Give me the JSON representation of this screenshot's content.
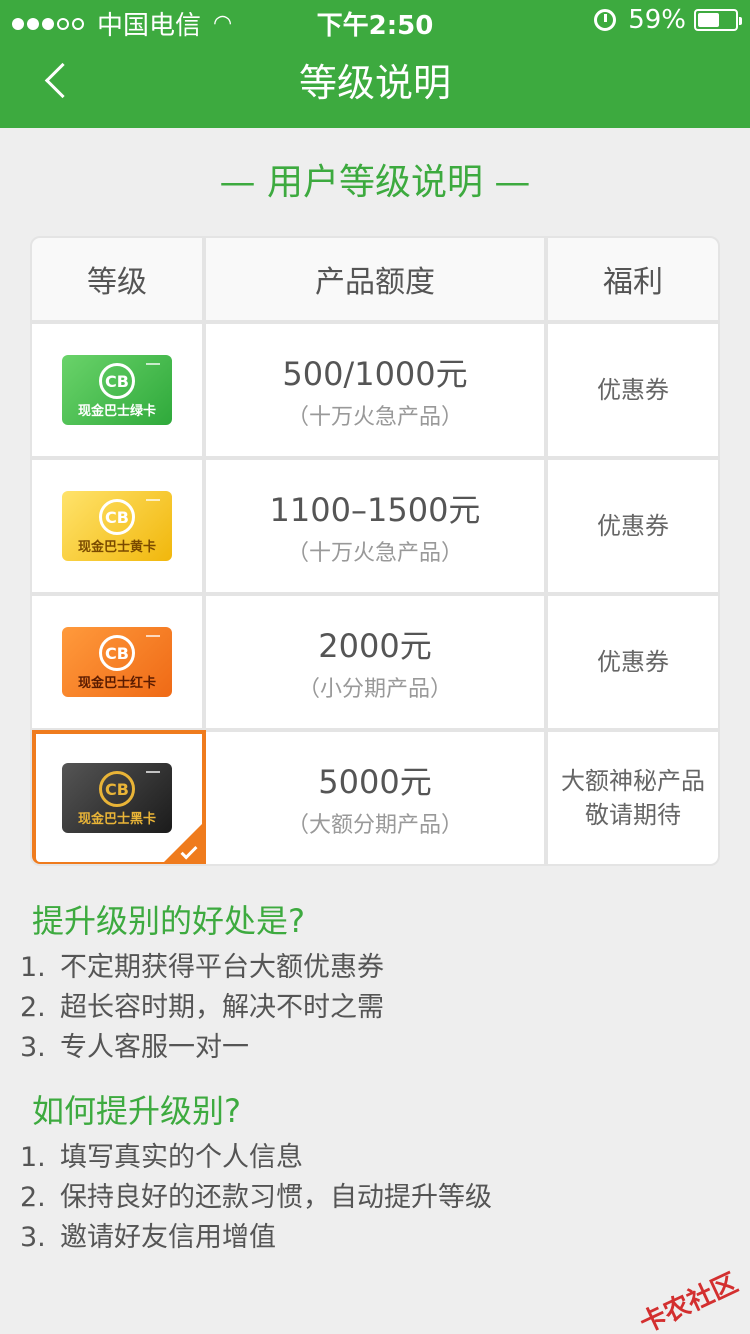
{
  "status": {
    "carrier": "中国电信",
    "time": "下午2:50",
    "battery": "59%",
    "battery_level": 0.59
  },
  "nav": {
    "title": "等级说明"
  },
  "section": {
    "title": "— 用户等级说明 —"
  },
  "table": {
    "headers": [
      "等级",
      "产品额度",
      "福利"
    ],
    "rows": [
      {
        "card_name": "现金巴士绿卡",
        "amount": "500/1000元",
        "note": "（十万火急产品）",
        "benefit": "优惠券",
        "benefit2": ""
      },
      {
        "card_name": "现金巴士黄卡",
        "amount": "1100–1500元",
        "note": "（十万火急产品）",
        "benefit": "优惠券",
        "benefit2": ""
      },
      {
        "card_name": "现金巴士红卡",
        "amount": "2000元",
        "note": "（小分期产品）",
        "benefit": "优惠券",
        "benefit2": ""
      },
      {
        "card_name": "现金巴士黑卡",
        "amount": "5000元",
        "note": "（大额分期产品）",
        "benefit": "大额神秘产品",
        "benefit2": "敬请期待"
      }
    ],
    "card_logo": "CB"
  },
  "benefits": {
    "title": "提升级别的好处是?",
    "items": [
      "不定期获得平台大额优惠券",
      "超长容时期，解决不时之需",
      "专人客服一对一"
    ]
  },
  "howto": {
    "title": "如何提升级别?",
    "items": [
      "填写真实的个人信息",
      "保持良好的还款习惯，自动提升等级",
      "邀请好友信用增值"
    ]
  },
  "watermark": "卡农社区",
  "colors": {
    "accent": "#3daa3f",
    "selected": "#ef7b1d"
  }
}
